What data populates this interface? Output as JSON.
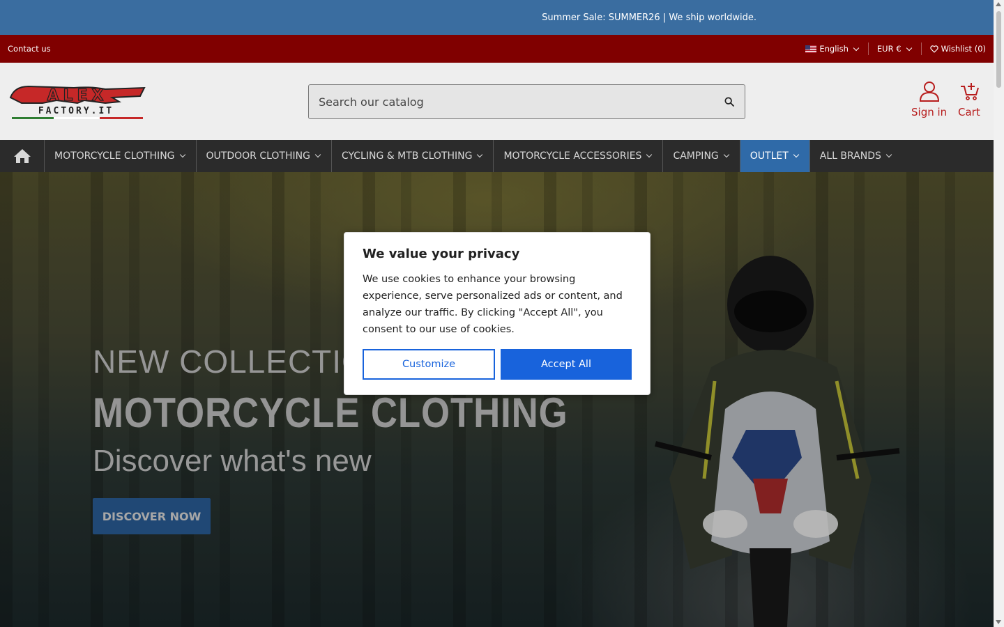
{
  "announcement": {
    "text": "Summer Sale: SUMMER26 | We ship worldwide."
  },
  "topbar": {
    "contact": "Contact us",
    "language": "English",
    "currency": "EUR €",
    "wishlist": "Wishlist (0)"
  },
  "header": {
    "logo_text": "ALEX FACTORY.IT",
    "search_placeholder": "Search our catalog",
    "signin": "Sign in",
    "cart": "Cart"
  },
  "nav": {
    "items": [
      {
        "label": "MOTORCYCLE CLOTHING"
      },
      {
        "label": "OUTDOOR CLOTHING"
      },
      {
        "label": "CYCLING & MTB CLOTHING"
      },
      {
        "label": "MOTORCYCLE ACCESSORIES"
      },
      {
        "label": "CAMPING"
      },
      {
        "label": "OUTLET"
      },
      {
        "label": "ALL BRANDS"
      }
    ]
  },
  "hero": {
    "subtitle": "NEW COLLECTION 2",
    "title": "MOTORCYCLE CLOTHING",
    "tagline": "Discover what's new",
    "button": "DISCOVER NOW"
  },
  "cookie": {
    "title": "We value your privacy",
    "body": "We use cookies to enhance your browsing experience, serve personalized ads or content, and analyze our traffic. By clicking \"Accept All\", you consent to our use of cookies.",
    "customize": "Customize",
    "accept": "Accept All"
  },
  "colors": {
    "announcement_bg": "#3a6da0",
    "topbar_bg": "#800000",
    "nav_bg": "#2b2b2b",
    "outlet_bg": "#2f6aa8",
    "brand_red": "#b71c1c",
    "cookie_blue": "#1863dc"
  }
}
